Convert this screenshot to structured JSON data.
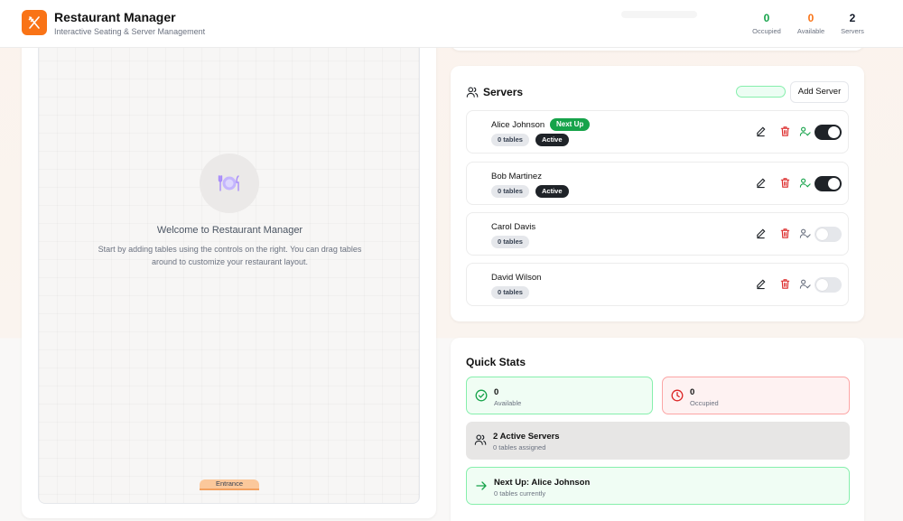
{
  "header": {
    "title": "Restaurant Manager",
    "subtitle": "Interactive Seating & Server Management",
    "stats": [
      {
        "value": "0",
        "label": "Occupied",
        "color": "#16a34a"
      },
      {
        "value": "0",
        "label": "Available",
        "color": "#f97316"
      },
      {
        "value": "2",
        "label": "Servers",
        "color": "#111827"
      }
    ]
  },
  "floor": {
    "welcome_title": "Welcome to Restaurant Manager",
    "welcome_text": "Start by adding tables using the controls on the right. You can drag tables around to customize your restaurant layout.",
    "entrance_label": "Entrance"
  },
  "servers_panel": {
    "title": "Servers",
    "add_button": "Add Server",
    "next_up_label": "Next Up",
    "active_label": "Active",
    "servers": [
      {
        "name": "Alice Johnson",
        "tables": "0 tables",
        "active": true,
        "next_up": true
      },
      {
        "name": "Bob Martinez",
        "tables": "0 tables",
        "active": true,
        "next_up": false
      },
      {
        "name": "Carol Davis",
        "tables": "0 tables",
        "active": false,
        "next_up": false
      },
      {
        "name": "David Wilson",
        "tables": "0 tables",
        "active": false,
        "next_up": false
      }
    ]
  },
  "quick_stats": {
    "title": "Quick Stats",
    "available": {
      "value": "0",
      "label": "Available"
    },
    "occupied": {
      "value": "0",
      "label": "Occupied"
    },
    "active_servers": {
      "title": "2 Active Servers",
      "sub": "0 tables assigned"
    },
    "next_up": {
      "title": "Next Up: Alice Johnson",
      "sub": "0 tables currently"
    }
  },
  "colors": {
    "accent": "#f97316",
    "green": "#16a34a",
    "red": "#dc2626",
    "dark": "#1f2328"
  }
}
